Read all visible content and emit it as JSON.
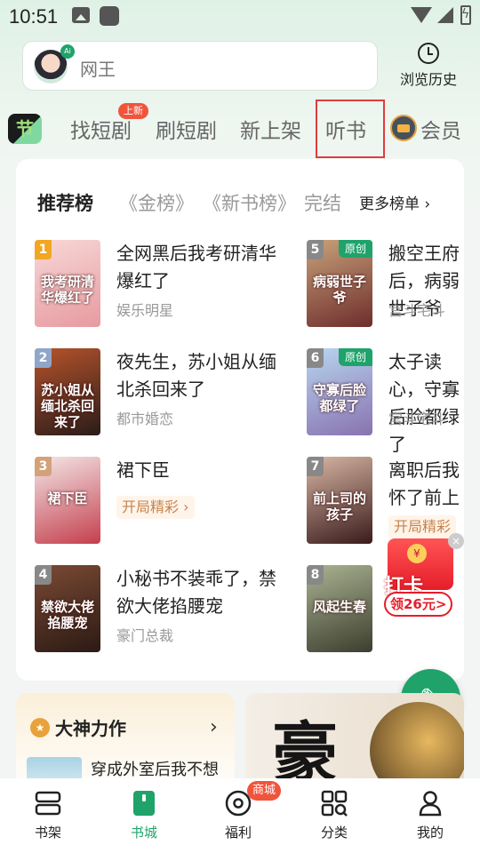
{
  "status_bar": {
    "time": "10:51"
  },
  "search": {
    "placeholder": "网王",
    "ai_badge": "Ai"
  },
  "header": {
    "history_label": "浏览历史"
  },
  "tabs": {
    "logo": "节",
    "items": [
      {
        "label": "找短剧"
      },
      {
        "label": "刷短剧"
      },
      {
        "label": "新上架"
      },
      {
        "label": "听书"
      },
      {
        "label": "会员"
      }
    ],
    "new_badge": "上新"
  },
  "ranking": {
    "title": "推荐榜",
    "tabs": [
      "金榜",
      "新书榜",
      "完结"
    ],
    "more_label": "更多榜单",
    "books": [
      {
        "rank": "1",
        "title": "全网黑后我考研清华爆红了",
        "category": "娱乐明星",
        "cover_text": "我考研清华爆红了",
        "rank_color": "#f2a623",
        "cover_colors": [
          "#f7d8d6",
          "#e79aa0"
        ]
      },
      {
        "rank": "2",
        "title": "夜先生，苏小姐从缅北杀回来了",
        "category": "都市婚恋",
        "cover_text": "苏小姐从缅北杀回来了",
        "rank_color": "#8fa6c8",
        "cover_colors": [
          "#b6532b",
          "#2a1c1a"
        ]
      },
      {
        "rank": "3",
        "title": "裙下臣",
        "category": "开局精彩",
        "cover_text": "裙下臣",
        "rank_color": "#d3a27b",
        "cover_colors": [
          "#f3e7e7",
          "#c43f4d"
        ]
      },
      {
        "rank": "4",
        "title": "小秘书不装乖了，禁欲大佬掐腰宠",
        "category": "豪门总裁",
        "cover_text": "禁欲大佬掐腰宠",
        "rank_color": "#888888",
        "cover_colors": [
          "#7b4a34",
          "#2b1a14"
        ]
      },
      {
        "rank": "5",
        "title": "搬空王府后，病弱世子爷",
        "category": "宫斗宅斗",
        "cover_text": "病弱世子爷",
        "tag": "原创",
        "rank_color": "#888888",
        "cover_colors": [
          "#c8a27a",
          "#6e2d2c"
        ]
      },
      {
        "rank": "6",
        "title": "太子读心，守寡后脸都绿了",
        "category": "宫斗宅斗",
        "cover_text": "守寡后脸都绿了",
        "tag": "原创",
        "rank_color": "#888888",
        "cover_colors": [
          "#b8d6f0",
          "#8872b0"
        ]
      },
      {
        "rank": "7",
        "title": "离职后我怀了前上司的孩子",
        "category": "开局精彩",
        "cover_text": "前上司的孩子",
        "rank_color": "#888888",
        "cover_colors": [
          "#d8b6a4",
          "#3a1b1b"
        ]
      },
      {
        "rank": "8",
        "title": "",
        "category": "",
        "cover_text": "风起生春",
        "rank_color": "#888888",
        "cover_colors": [
          "#aab392",
          "#3c3e2e"
        ]
      }
    ]
  },
  "checkin": {
    "label": "打卡",
    "reward": "领26元>",
    "close": "×",
    "coin": "¥"
  },
  "fab": {
    "icon": "✎"
  },
  "god_card": {
    "title": "大神力作",
    "book": "穿成外室后我不想",
    "arrow": "›"
  },
  "promo_card": {
    "character": "豪"
  },
  "bottom_nav": {
    "items": [
      {
        "label": "书架"
      },
      {
        "label": "书城"
      },
      {
        "label": "福利"
      },
      {
        "label": "分类"
      },
      {
        "label": "我的"
      }
    ],
    "shop_badge": "商城"
  },
  "colors": {
    "accent": "#1fa36b",
    "badge": "#f0553c",
    "highlight": "#e03c3c"
  }
}
